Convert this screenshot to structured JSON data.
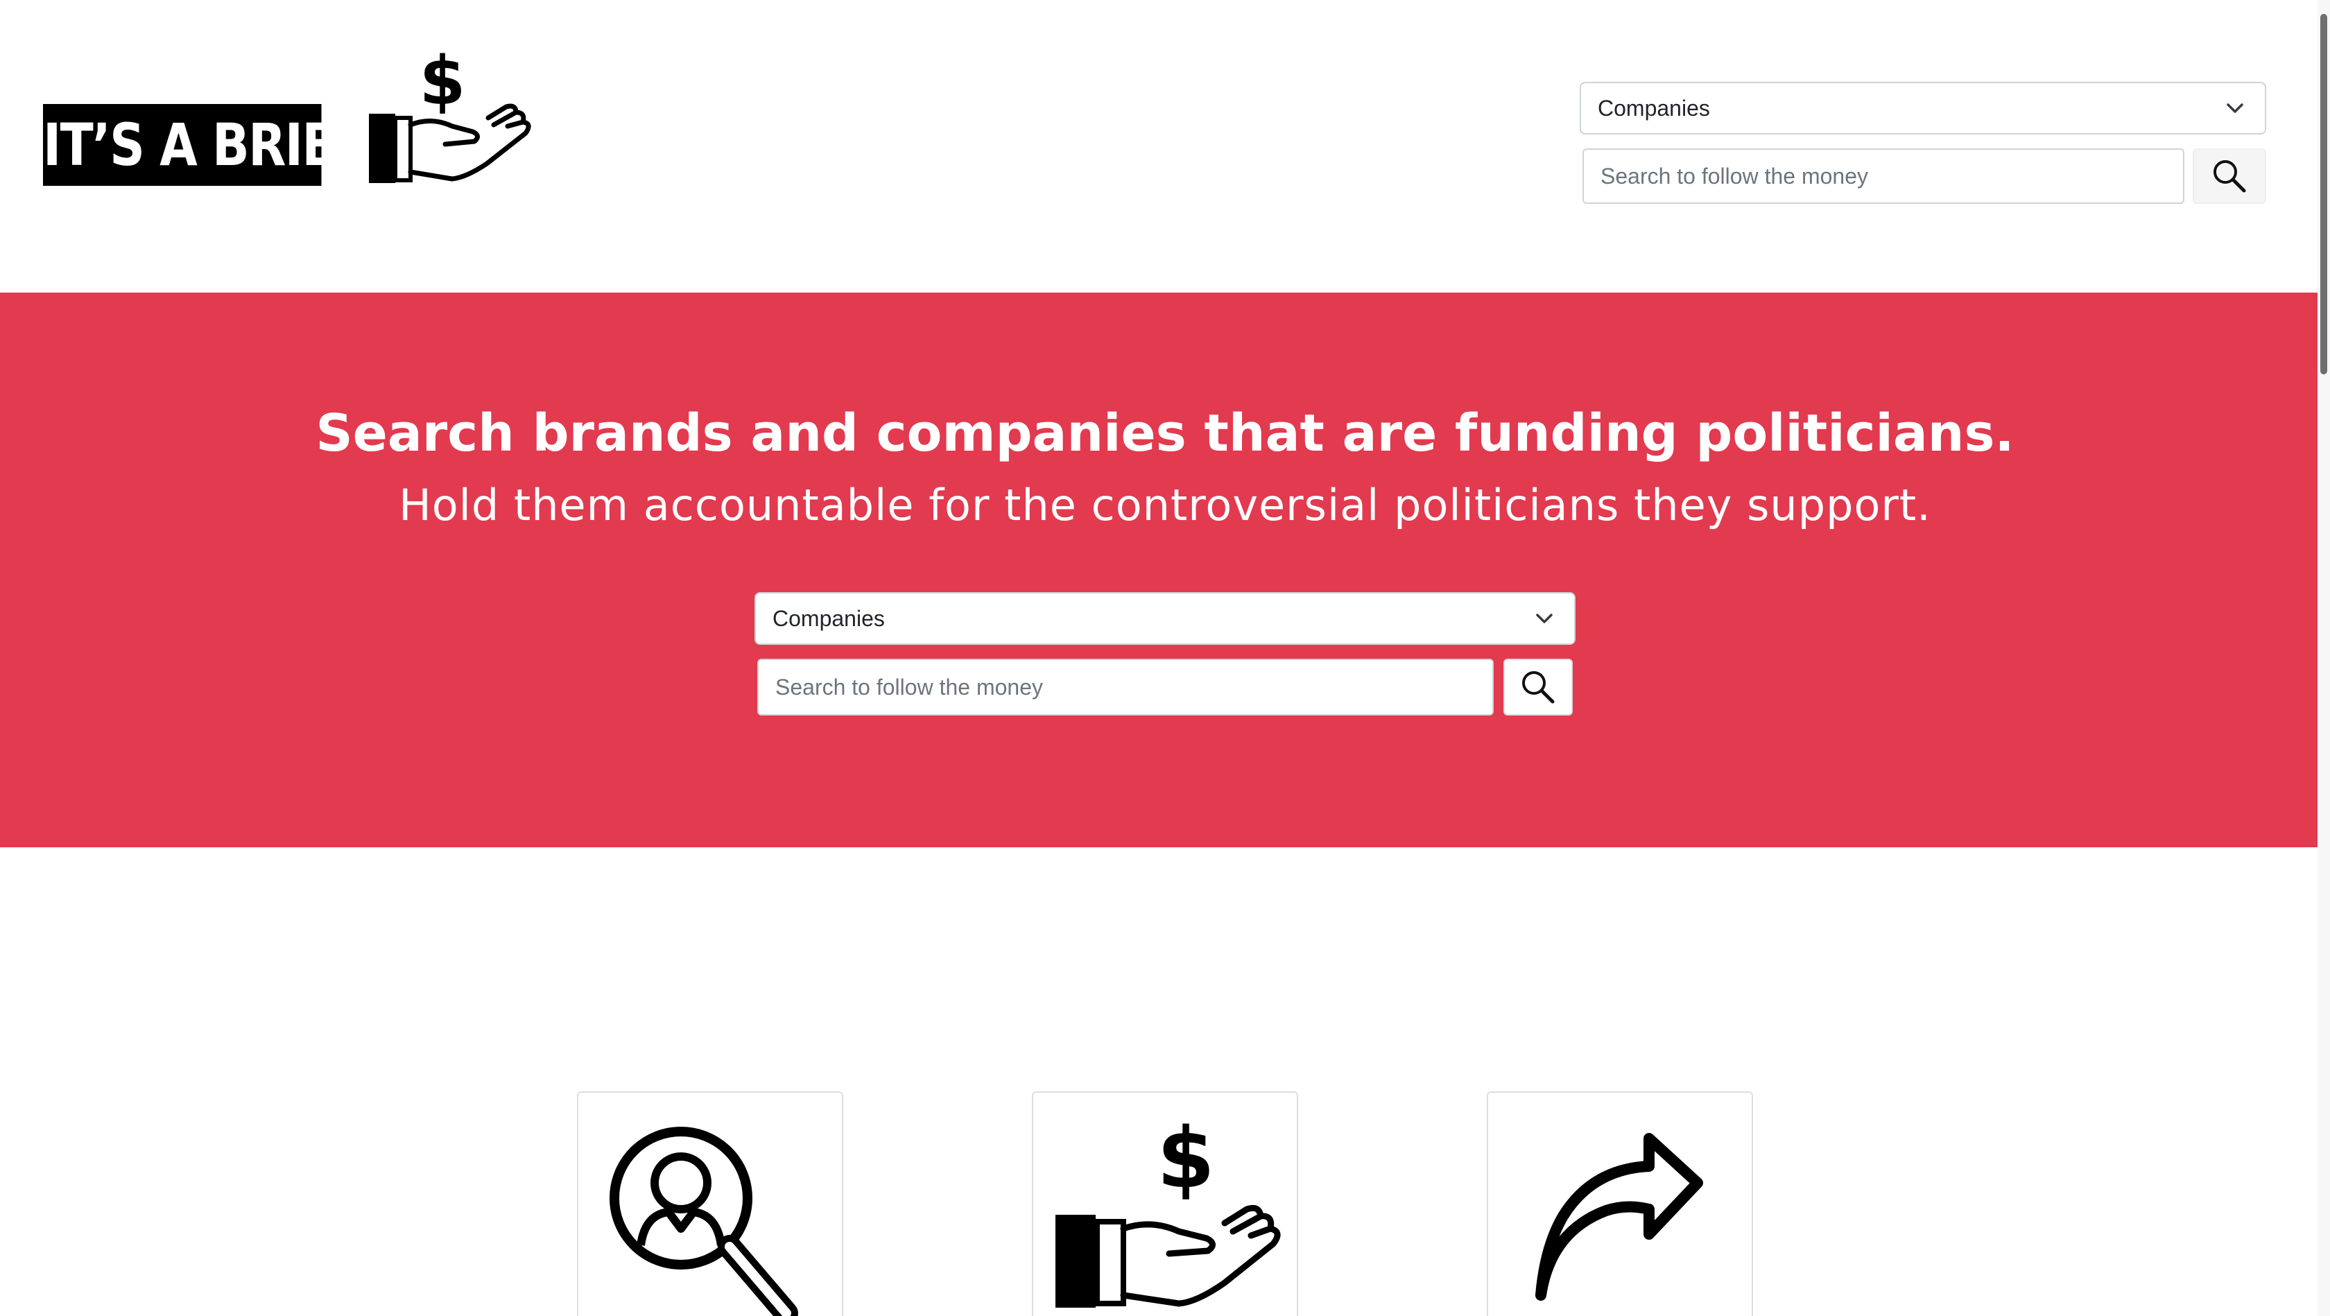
{
  "header": {
    "logo_text": "IT’S A BRIBE",
    "logo_symbol": "$",
    "search_type": {
      "selected": "Companies",
      "options": [
        "Companies"
      ]
    },
    "search_placeholder": "Search to follow the money"
  },
  "hero": {
    "title": "Search brands and companies that are funding politicians.",
    "subtitle": "Hold them accountable for the controversial politicians they support.",
    "search_type": {
      "selected": "Companies",
      "options": [
        "Companies"
      ]
    },
    "search_placeholder": "Search to follow the money",
    "background_color": "#e23a4f"
  },
  "features": [
    {
      "icon": "magnifier-person-icon"
    },
    {
      "icon": "money-hand-icon",
      "symbol": "$"
    },
    {
      "icon": "share-arrow-icon"
    }
  ],
  "colors": {
    "brand_red": "#e23a4f",
    "text_dark": "#212529",
    "placeholder": "#6c757d"
  }
}
